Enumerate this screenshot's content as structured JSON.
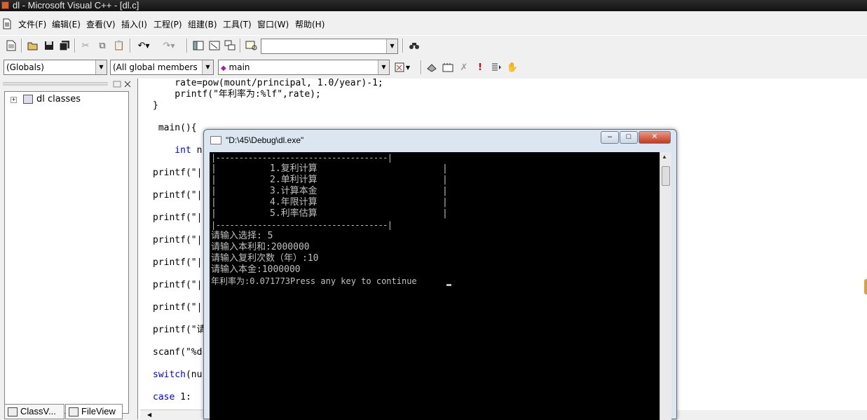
{
  "window": {
    "title": "dl - Microsoft Visual C++ - [dl.c]"
  },
  "menu": [
    "文件(F)",
    "编辑(E)",
    "查看(V)",
    "插入(I)",
    "工程(P)",
    "组建(B)",
    "工具(T)",
    "窗口(W)",
    "帮助(H)"
  ],
  "toolbar2": {
    "scope_combo": "(Globals)",
    "members_combo": "(All global members",
    "function_combo": "main"
  },
  "workspace": {
    "tree_root": "dl classes",
    "tabs": [
      "ClassV...",
      "FileView"
    ]
  },
  "editor": {
    "lines": {
      "l1": "    rate=pow(mount/principal, 1.0/year)-1;",
      "l2": "    printf(\"年利率为:%lf\",rate);",
      "l3": "}",
      "l4": " main(){",
      "l5_kw": "    int",
      "l5_rest": " n",
      "p1": "printf(\"|",
      "p2": "printf(\"|",
      "p3": "printf(\"|",
      "p4": "printf(\"|",
      "p5": "printf(\"|",
      "p6": "printf(\"|",
      "p7": "printf(\"|",
      "p8": "printf(\"请",
      "scanf": "scanf(\"%d",
      "switch_kw": "switch",
      "switch_rest": "(nu",
      "case_kw": "case",
      "case_rest": " 1:"
    }
  },
  "console": {
    "title": "\"D:\\45\\Debug\\dl.exe\"",
    "border_top": "|-------------------------------------|",
    "border_bottom": "|-------------------------------------|",
    "bar": "|",
    "menu_items": [
      "1.复利计算",
      "2.单利计算",
      "3.计算本金",
      "4.年限计算",
      "5.利率估算"
    ],
    "output_lines": [
      "请输入选择: 5",
      "请输入本利和:2000000",
      "请输入复利次数（年）:10",
      "请输入本金:1000000",
      "年利率为:0.071773Press any key to continue"
    ],
    "buttons": {
      "minimize": "–",
      "maximize": "□",
      "close": "✕"
    }
  }
}
